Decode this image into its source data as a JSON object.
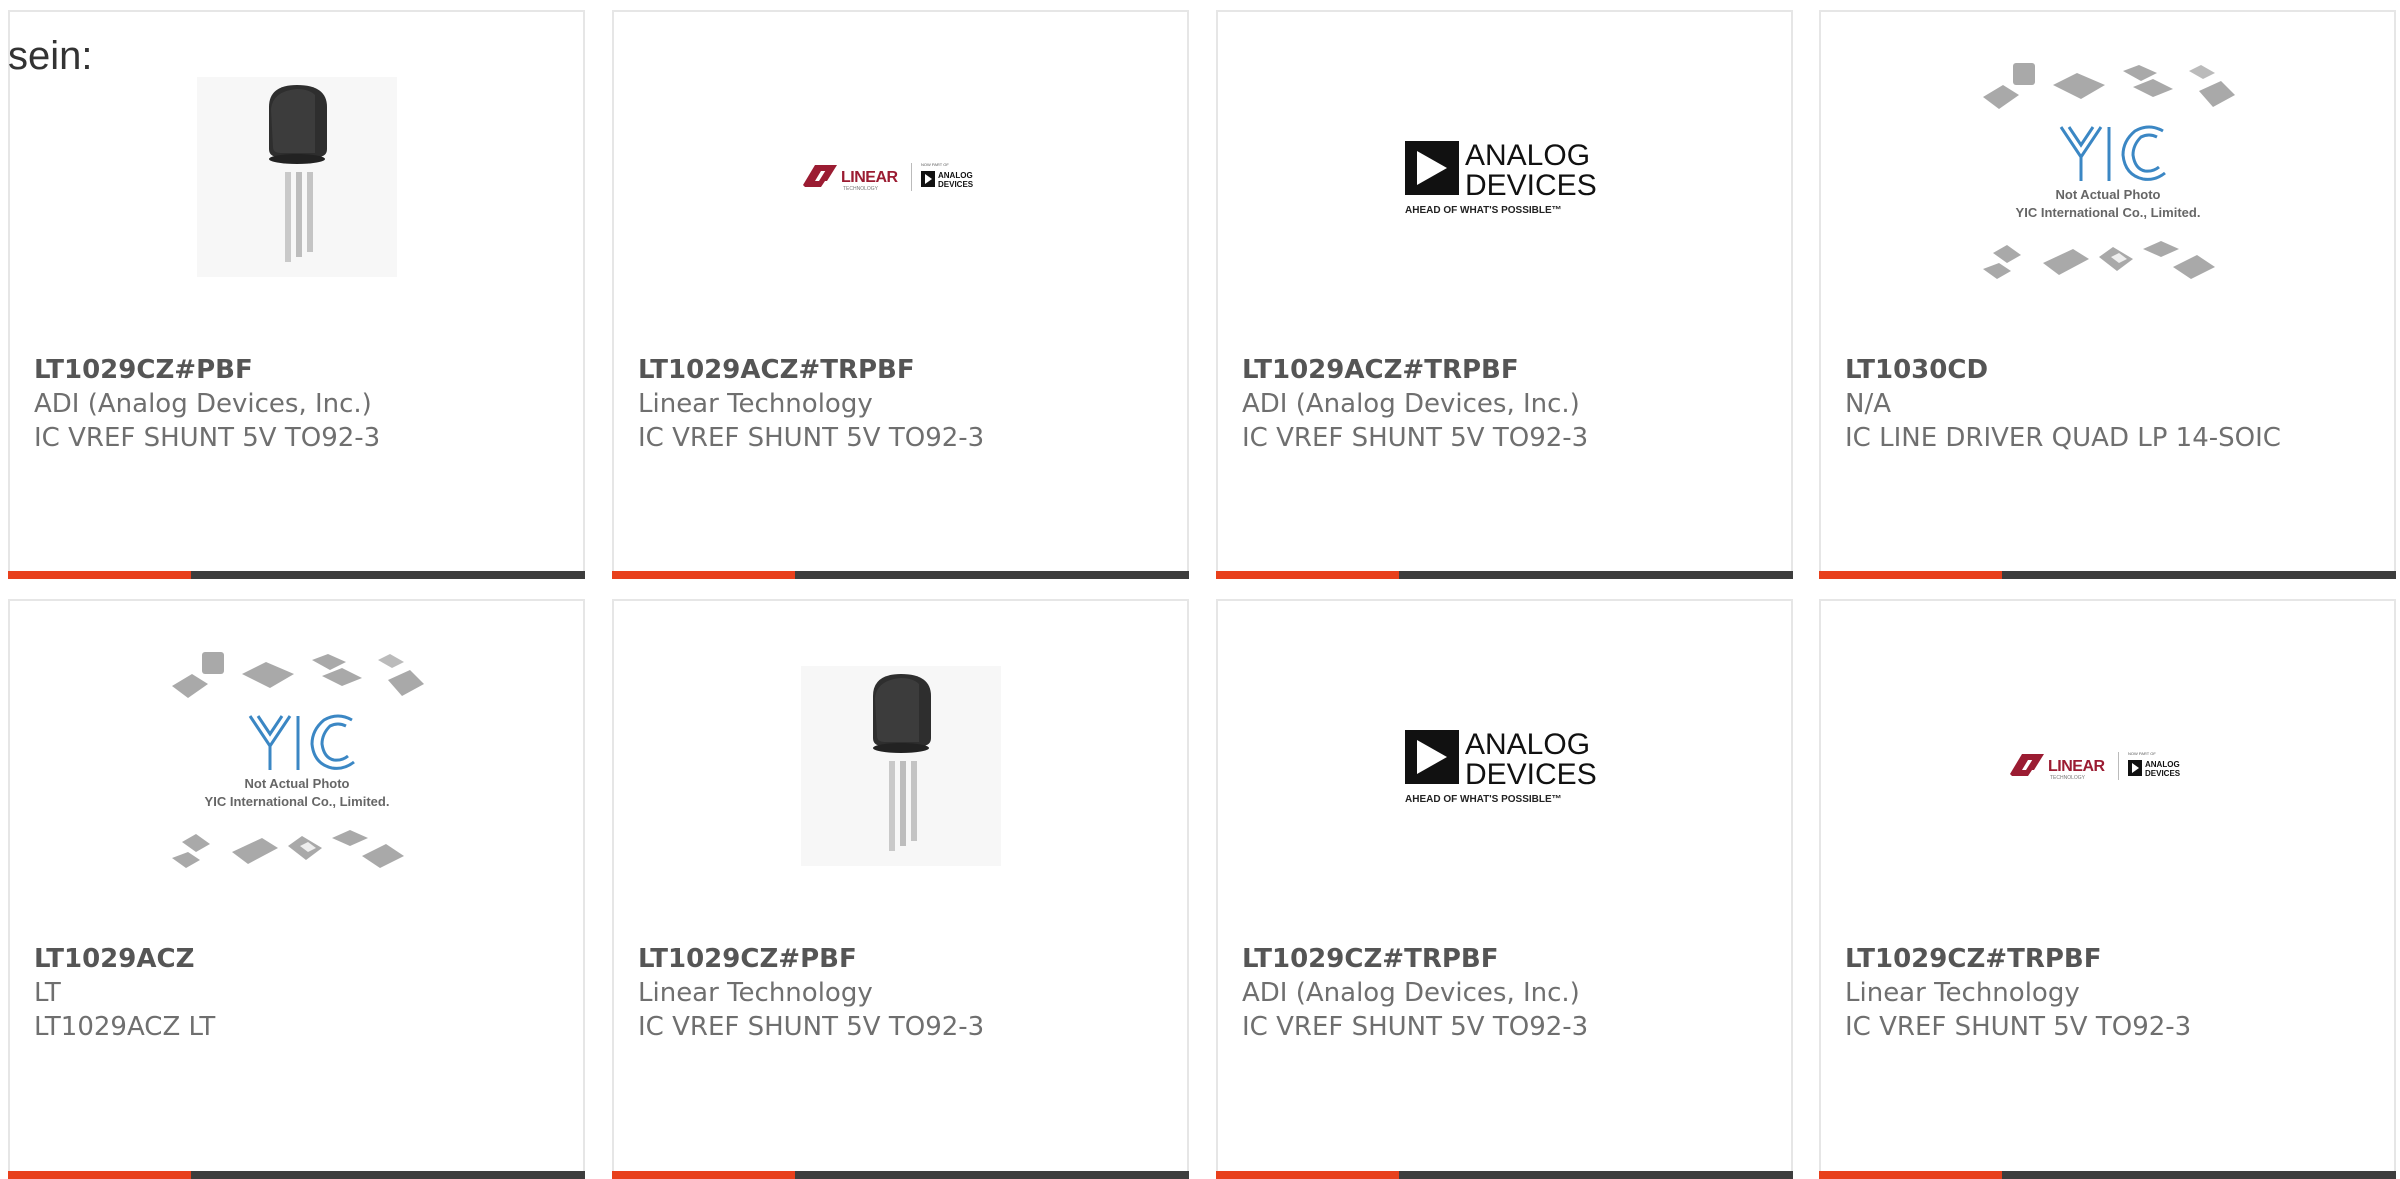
{
  "intro_text": "sein:",
  "colors": {
    "accent": "#e8401c",
    "bar": "#3d3d3d",
    "border": "#e6e6e6",
    "text": "#6f6f6f"
  },
  "cards": [
    {
      "part_number": "LT1029CZ#PBF",
      "manufacturer": "ADI (Analog Devices, Inc.)",
      "description": "IC VREF SHUNT 5V TO92-3",
      "image": "to92-transistor-photo"
    },
    {
      "part_number": "LT1029ACZ#TRPBF",
      "manufacturer": "Linear Technology",
      "description": "IC VREF SHUNT 5V TO92-3",
      "image": "linear-technology-logo",
      "logo": {
        "brand": "LINEAR",
        "sub": "TECHNOLOGY",
        "tag": "NOW PART OF",
        "partner_line1": "ANALOG",
        "partner_line2": "DEVICES"
      }
    },
    {
      "part_number": "LT1029ACZ#TRPBF",
      "manufacturer": "ADI (Analog Devices, Inc.)",
      "description": "IC VREF SHUNT 5V TO92-3",
      "image": "analog-devices-logo",
      "logo": {
        "line1": "ANALOG",
        "line2": "DEVICES",
        "tagline": "AHEAD OF WHAT'S POSSIBLE™"
      }
    },
    {
      "part_number": "LT1030CD",
      "manufacturer": "N/A",
      "description": "IC LINE DRIVER QUAD LP 14-SOIC",
      "image": "yic-placeholder",
      "logo": {
        "mark": "YIC",
        "line1": "Not Actual Photo",
        "line2": "YIC International Co., Limited."
      }
    },
    {
      "part_number": "LT1029ACZ",
      "manufacturer": "LT",
      "description": "LT1029ACZ LT",
      "image": "yic-placeholder",
      "logo": {
        "mark": "YIC",
        "line1": "Not Actual Photo",
        "line2": "YIC International Co., Limited."
      }
    },
    {
      "part_number": "LT1029CZ#PBF",
      "manufacturer": "Linear Technology",
      "description": "IC VREF SHUNT 5V TO92-3",
      "image": "to92-transistor-photo"
    },
    {
      "part_number": "LT1029CZ#TRPBF",
      "manufacturer": "ADI (Analog Devices, Inc.)",
      "description": "IC VREF SHUNT 5V TO92-3",
      "image": "analog-devices-logo",
      "logo": {
        "line1": "ANALOG",
        "line2": "DEVICES",
        "tagline": "AHEAD OF WHAT'S POSSIBLE™"
      }
    },
    {
      "part_number": "LT1029CZ#TRPBF",
      "manufacturer": "Linear Technology",
      "description": "IC VREF SHUNT 5V TO92-3",
      "image": "linear-technology-logo",
      "logo": {
        "brand": "LINEAR",
        "sub": "TECHNOLOGY",
        "tag": "NOW PART OF",
        "partner_line1": "ANALOG",
        "partner_line2": "DEVICES"
      }
    }
  ]
}
